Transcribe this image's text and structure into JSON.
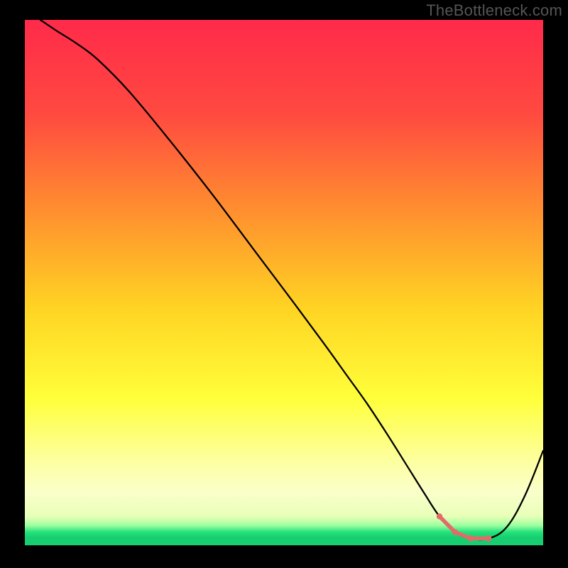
{
  "watermark": "TheBottleneck.com",
  "chart_data": {
    "type": "line",
    "title": "",
    "xlabel": "",
    "ylabel": "",
    "xlim": [
      0,
      100
    ],
    "ylim": [
      0,
      100
    ],
    "background_gradient": {
      "stops": [
        {
          "offset": 0.0,
          "color": "#ff2a4a"
        },
        {
          "offset": 0.18,
          "color": "#ff4a40"
        },
        {
          "offset": 0.35,
          "color": "#ff8a30"
        },
        {
          "offset": 0.55,
          "color": "#ffd423"
        },
        {
          "offset": 0.72,
          "color": "#ffff3a"
        },
        {
          "offset": 0.84,
          "color": "#fdffa0"
        },
        {
          "offset": 0.9,
          "color": "#faffca"
        },
        {
          "offset": 0.945,
          "color": "#e8ffb8"
        },
        {
          "offset": 0.962,
          "color": "#9effa0"
        },
        {
          "offset": 0.975,
          "color": "#24e27a"
        },
        {
          "offset": 0.985,
          "color": "#17cf71"
        },
        {
          "offset": 1.0,
          "color": "#17cf71"
        }
      ]
    },
    "series": [
      {
        "name": "curve",
        "stroke": "#000000",
        "stroke_width": 2.3,
        "x": [
          3,
          6,
          10,
          14,
          20,
          28,
          36,
          44,
          52,
          58,
          62,
          66,
          70,
          73.5,
          77,
          80,
          83,
          86,
          89.5,
          93,
          96.5,
          100
        ],
        "y": [
          100,
          98,
          95.5,
          92.5,
          86.5,
          77,
          67,
          56.5,
          46,
          38,
          32.5,
          27,
          21,
          15.5,
          10,
          5.5,
          2.5,
          1.3,
          1.3,
          3.5,
          9.5,
          18
        ]
      }
    ],
    "highlight": {
      "name": "minimum-band",
      "stroke": "#e46a6a",
      "stroke_width": 5.5,
      "dots_radius": 4.2,
      "x": [
        73.5,
        77,
        80,
        83,
        86,
        89.5
      ],
      "y": [
        15.5,
        10,
        5.5,
        2.5,
        1.3,
        1.3
      ],
      "visible_from_index": 2
    }
  }
}
